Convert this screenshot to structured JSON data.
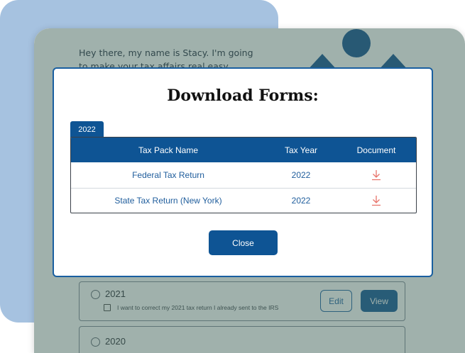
{
  "background": {
    "greeting": "Hey there, my name is Stacy. I'm going to make your tax affairs real easy.",
    "returns": [
      {
        "year": "2021",
        "checkbox_label": "I want to correct my 2021 tax return I already sent to the IRS",
        "edit_label": "Edit",
        "view_label": "View"
      },
      {
        "year": "2020"
      }
    ]
  },
  "modal": {
    "title": "Download Forms:",
    "year_tab": "2022",
    "columns": [
      "Tax Pack Name",
      "Tax Year",
      "Document"
    ],
    "rows": [
      {
        "name": "Federal Tax Return",
        "year": "2022",
        "document_icon": "download-icon"
      },
      {
        "name": "State Tax Return (New York)",
        "year": "2022",
        "document_icon": "download-icon"
      }
    ],
    "close_label": "Close"
  },
  "colors": {
    "primary": "#0e5494",
    "overlay": "#6f8f86",
    "accent_card": "#a6c2e0",
    "download_icon": "#e8736a"
  }
}
